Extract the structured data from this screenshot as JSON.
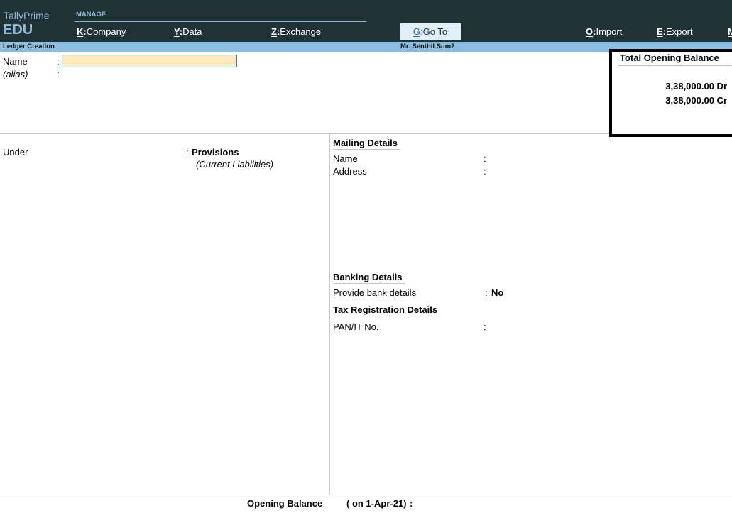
{
  "app": {
    "brand_name": "TallyPrime",
    "brand_edition": "EDU"
  },
  "menu": {
    "section_label": "MANAGE",
    "items": [
      {
        "key": "K",
        "label": "Company"
      },
      {
        "key": "Y",
        "label": "Data"
      },
      {
        "key": "Z",
        "label": "Exchange"
      },
      {
        "key": "G",
        "label": "Go To"
      },
      {
        "key": "O",
        "label": "Import"
      },
      {
        "key": "E",
        "label": "Export"
      },
      {
        "key": "M",
        "label": ""
      }
    ]
  },
  "header": {
    "screen_title": "Ledger Creation",
    "company_name": "Mr. Senthil Sum2"
  },
  "form": {
    "name_label": "Name",
    "name_value": "",
    "alias_label": "(alias)",
    "colon": ":",
    "under_label": "Under",
    "under_value": "Provisions",
    "under_group": "(Current Liabilities)"
  },
  "total_opening_balance": {
    "title": "Total Opening Balance",
    "debit": "3,38,000.00 Dr",
    "credit": "3,38,000.00 Cr"
  },
  "mailing": {
    "title": "Mailing Details",
    "name_label": "Name",
    "address_label": "Address"
  },
  "banking": {
    "title": "Banking Details",
    "provide_label": "Provide bank details",
    "provide_value": "No"
  },
  "tax": {
    "title": "Tax Registration Details",
    "pan_label": "PAN/IT No."
  },
  "footer": {
    "opening_balance_label": "Opening Balance",
    "opening_balance_date": "( on 1-Apr-21)",
    "colon": ":"
  }
}
